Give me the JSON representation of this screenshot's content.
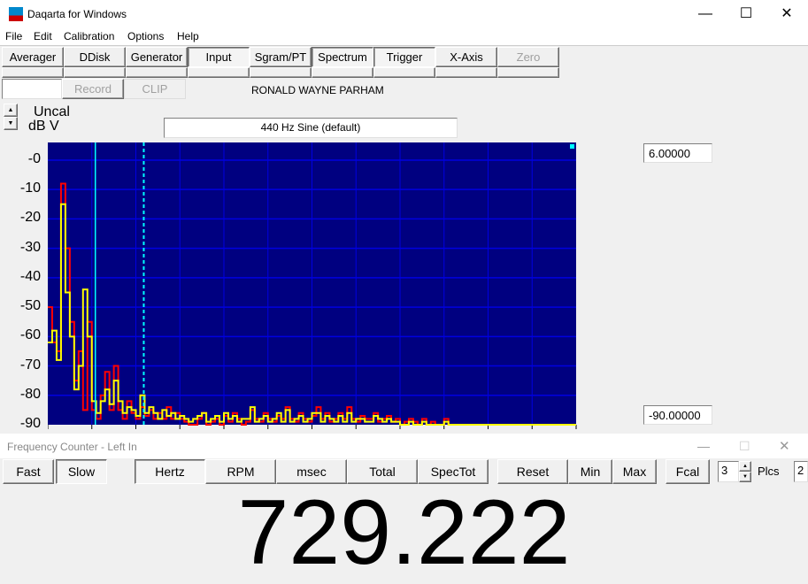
{
  "window": {
    "title": "Daqarta for Windows",
    "minimize": "—",
    "maximize": "☐",
    "close": "✕"
  },
  "menu": [
    "File",
    "Edit",
    "Calibration",
    "Options",
    "Help"
  ],
  "toolbar": [
    {
      "label": "Averager",
      "state": "normal"
    },
    {
      "label": "DDisk",
      "state": "normal"
    },
    {
      "label": "Generator",
      "state": "normal"
    },
    {
      "label": "Input",
      "state": "pressed"
    },
    {
      "label": "Sgram/PT",
      "state": "normal"
    },
    {
      "label": "Spectrum",
      "state": "pressed"
    },
    {
      "label": "Trigger",
      "state": "pressed"
    },
    {
      "label": "X-Axis",
      "state": "normal"
    },
    {
      "label": "Zero",
      "state": "disabled"
    }
  ],
  "row2": {
    "record": "Record",
    "clip": "CLIP",
    "user": "RONALD WAYNE PARHAM"
  },
  "scale": {
    "line1": "Uncal",
    "line2": "dB V",
    "up": "▲",
    "down": "▼"
  },
  "generator_field": "440 Hz Sine (default)",
  "readouts": {
    "top": "6.00000",
    "bottom": "-90.00000"
  },
  "colors": {
    "plot_bg": "#000080",
    "grid": "#0000e0",
    "trace_red": "#ff0000",
    "trace_yellow": "#ffff00",
    "cursor": "#00ffff"
  },
  "chart_data": {
    "type": "line",
    "yticks": [
      "-0",
      "-10",
      "-20",
      "-30",
      "-40",
      "-50",
      "-60",
      "-70",
      "-80",
      "-90"
    ],
    "ylim": [
      -90,
      6
    ],
    "xlim": [
      0,
      120
    ],
    "grid": true,
    "cursors": [
      {
        "x": 10.8,
        "style": "solid"
      },
      {
        "x": 21.8,
        "style": "dashed"
      }
    ],
    "series": [
      {
        "color": "red",
        "values": [
          -50,
          -62,
          -65,
          -8,
          -30,
          -55,
          -75,
          -65,
          -85,
          -55,
          -85,
          -88,
          -80,
          -72,
          -85,
          -70,
          -85,
          -88,
          -82,
          -86,
          -88,
          -84,
          -87,
          -85,
          -88,
          -86,
          -88,
          -84,
          -88,
          -86,
          -88,
          -89,
          -90,
          -90,
          -88,
          -86,
          -90,
          -89,
          -88,
          -90,
          -87,
          -89,
          -86,
          -88,
          -90,
          -89,
          -85,
          -88,
          -89,
          -86,
          -88,
          -89,
          -87,
          -88,
          -84,
          -88,
          -89,
          -86,
          -88,
          -89,
          -87,
          -84,
          -88,
          -86,
          -89,
          -88,
          -86,
          -88,
          -84,
          -88,
          -89,
          -87,
          -88,
          -88,
          -86,
          -89,
          -88,
          -87,
          -89,
          -88,
          -90,
          -89,
          -88,
          -89,
          -90,
          -88,
          -90,
          -89,
          -90,
          -90,
          -88,
          -90,
          -90,
          -90,
          -90,
          -90,
          -90,
          -90,
          -90,
          -90,
          -90,
          -90,
          -90,
          -90,
          -90,
          -90,
          -90,
          -90,
          -90,
          -90,
          -90,
          -90,
          -90,
          -90,
          -90,
          -90,
          -90,
          -90,
          -90,
          -90
        ]
      },
      {
        "color": "yellow",
        "values": [
          -62,
          -58,
          -68,
          -15,
          -45,
          -60,
          -78,
          -70,
          -44,
          -60,
          -82,
          -86,
          -82,
          -78,
          -83,
          -75,
          -82,
          -86,
          -84,
          -85,
          -87,
          -80,
          -86,
          -84,
          -86,
          -88,
          -85,
          -87,
          -86,
          -88,
          -87,
          -88,
          -89,
          -88,
          -87,
          -86,
          -89,
          -88,
          -87,
          -89,
          -86,
          -88,
          -87,
          -89,
          -88,
          -88,
          -84,
          -89,
          -88,
          -87,
          -89,
          -88,
          -86,
          -89,
          -85,
          -89,
          -88,
          -87,
          -89,
          -88,
          -86,
          -86,
          -89,
          -87,
          -88,
          -89,
          -87,
          -89,
          -86,
          -89,
          -88,
          -88,
          -89,
          -89,
          -87,
          -88,
          -89,
          -88,
          -89,
          -89,
          -90,
          -90,
          -89,
          -90,
          -90,
          -89,
          -90,
          -90,
          -90,
          -90,
          -89,
          -90,
          -90,
          -90,
          -90,
          -90,
          -90,
          -90,
          -90,
          -90,
          -90,
          -90,
          -90,
          -90,
          -90,
          -90,
          -90,
          -90,
          -90,
          -90,
          -90,
          -90,
          -90,
          -90,
          -90,
          -90,
          -90,
          -90,
          -90,
          -90
        ]
      }
    ]
  },
  "freq_counter": {
    "title": "Frequency Counter - Left In",
    "buttons": [
      "Fast",
      "Slow",
      "Hertz",
      "RPM",
      "msec",
      "Total",
      "SpecTot",
      "Reset",
      "Min",
      "Max",
      "Fcal"
    ],
    "places_value": "3",
    "places_label": "Plcs",
    "extra": "2",
    "value": "729.222",
    "minimize": "—",
    "maximize": "☐",
    "close": "✕"
  }
}
